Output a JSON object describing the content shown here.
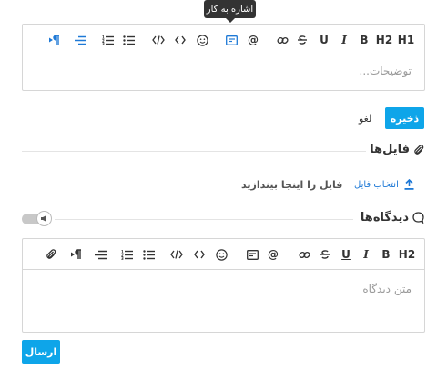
{
  "tooltip": "اشاره به کار",
  "description_editor": {
    "toolbar": [
      "H1",
      "H2",
      "B",
      "I",
      "U",
      "S",
      "link",
      "@",
      "task",
      "☺",
      "‹›",
      "</>",
      "ul",
      "ol",
      "align",
      "rtl"
    ],
    "placeholder": "توضیحات..."
  },
  "actions": {
    "save_label": "ذخیره",
    "cancel_label": "لغو"
  },
  "files": {
    "title": "فایل‌ها",
    "drop_text": "فایل را اینجا بیندازید",
    "choose_label": "انتخاب فایل"
  },
  "comments": {
    "title": "دیدگاه‌ها",
    "placeholder": "متن دیدگاه",
    "send_label": "ارسال"
  },
  "icons": {
    "h1": "H1",
    "h2": "H2",
    "bold": "B",
    "italic": "I",
    "underline": "U",
    "ellipsis": "...",
    "pilcrow": "¶",
    "mention": "@"
  },
  "colors": {
    "accent": "#0ea5e9",
    "link": "#1e79d6"
  }
}
